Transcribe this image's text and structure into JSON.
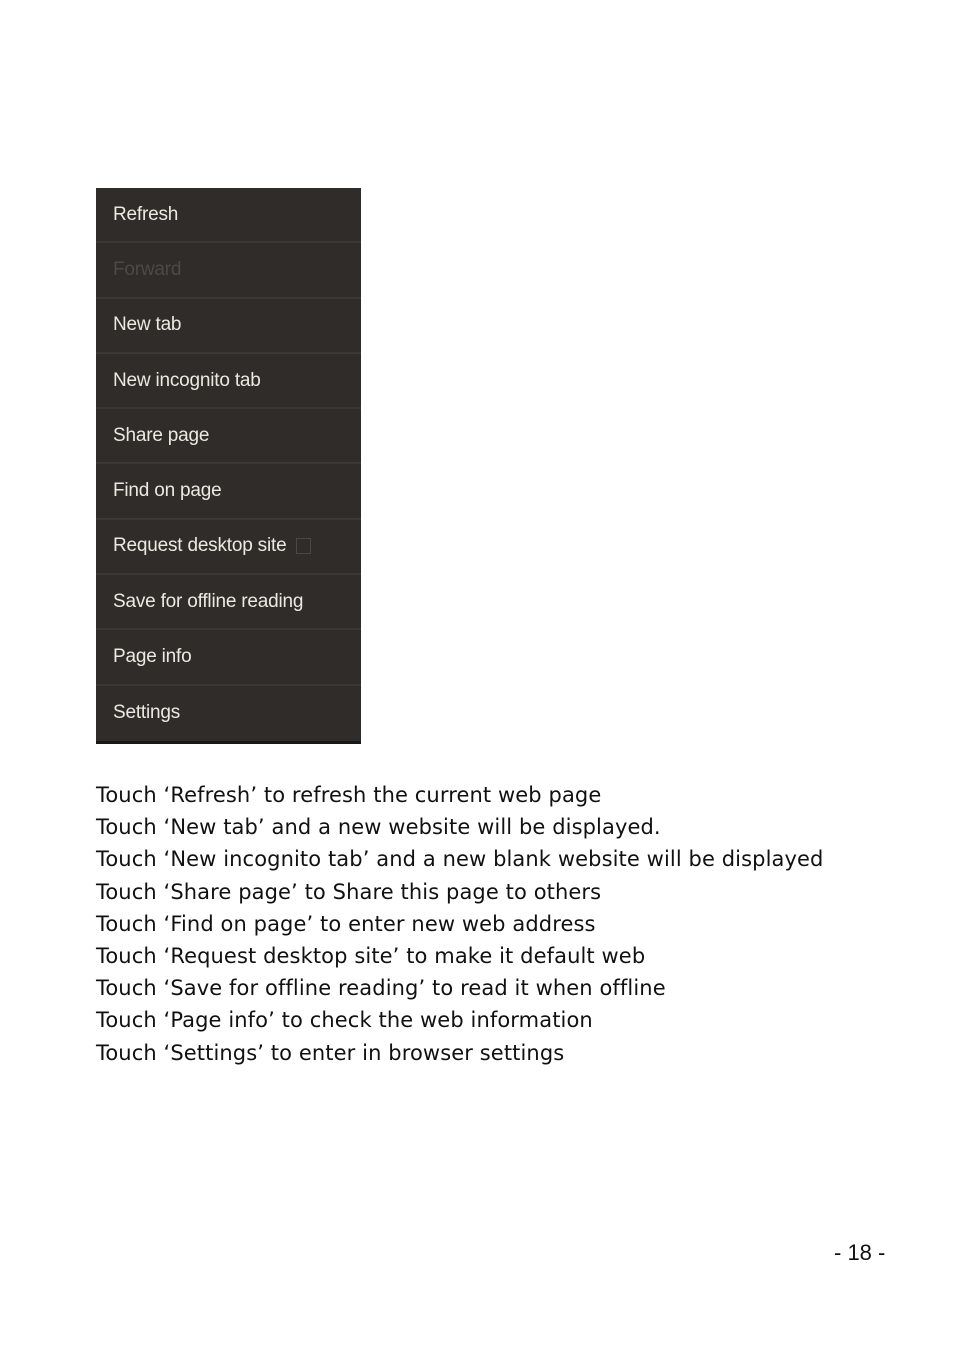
{
  "menu": {
    "items": [
      {
        "label": "Refresh",
        "disabled": false
      },
      {
        "label": "Forward",
        "disabled": true
      },
      {
        "label": "New tab",
        "disabled": false
      },
      {
        "label": "New incognito tab",
        "disabled": false
      },
      {
        "label": "Share page",
        "disabled": false
      },
      {
        "label": "Find on page",
        "disabled": false
      },
      {
        "label": "Request desktop site",
        "disabled": false,
        "checkbox": false
      },
      {
        "label": "Save for offline reading",
        "disabled": false
      },
      {
        "label": "Page info",
        "disabled": false
      },
      {
        "label": "Settings",
        "disabled": false
      }
    ]
  },
  "instructions": [
    "Touch ‘Refresh’ to refresh the current web page",
    "Touch ‘New tab’ and a new website will be displayed.",
    "Touch ‘New incognito tab’ and a new blank website will be displayed",
    "Touch ‘Share page’ to Share this page to others",
    "Touch ‘Find on page’ to enter new web address",
    "Touch ‘Request desktop site’ to make it default web",
    "Touch ‘Save for offline reading’ to read it when offline",
    "Touch ‘Page info’ to check the web information",
    "Touch ‘Settings’ to enter in browser settings"
  ],
  "page_number": "- 18 -"
}
